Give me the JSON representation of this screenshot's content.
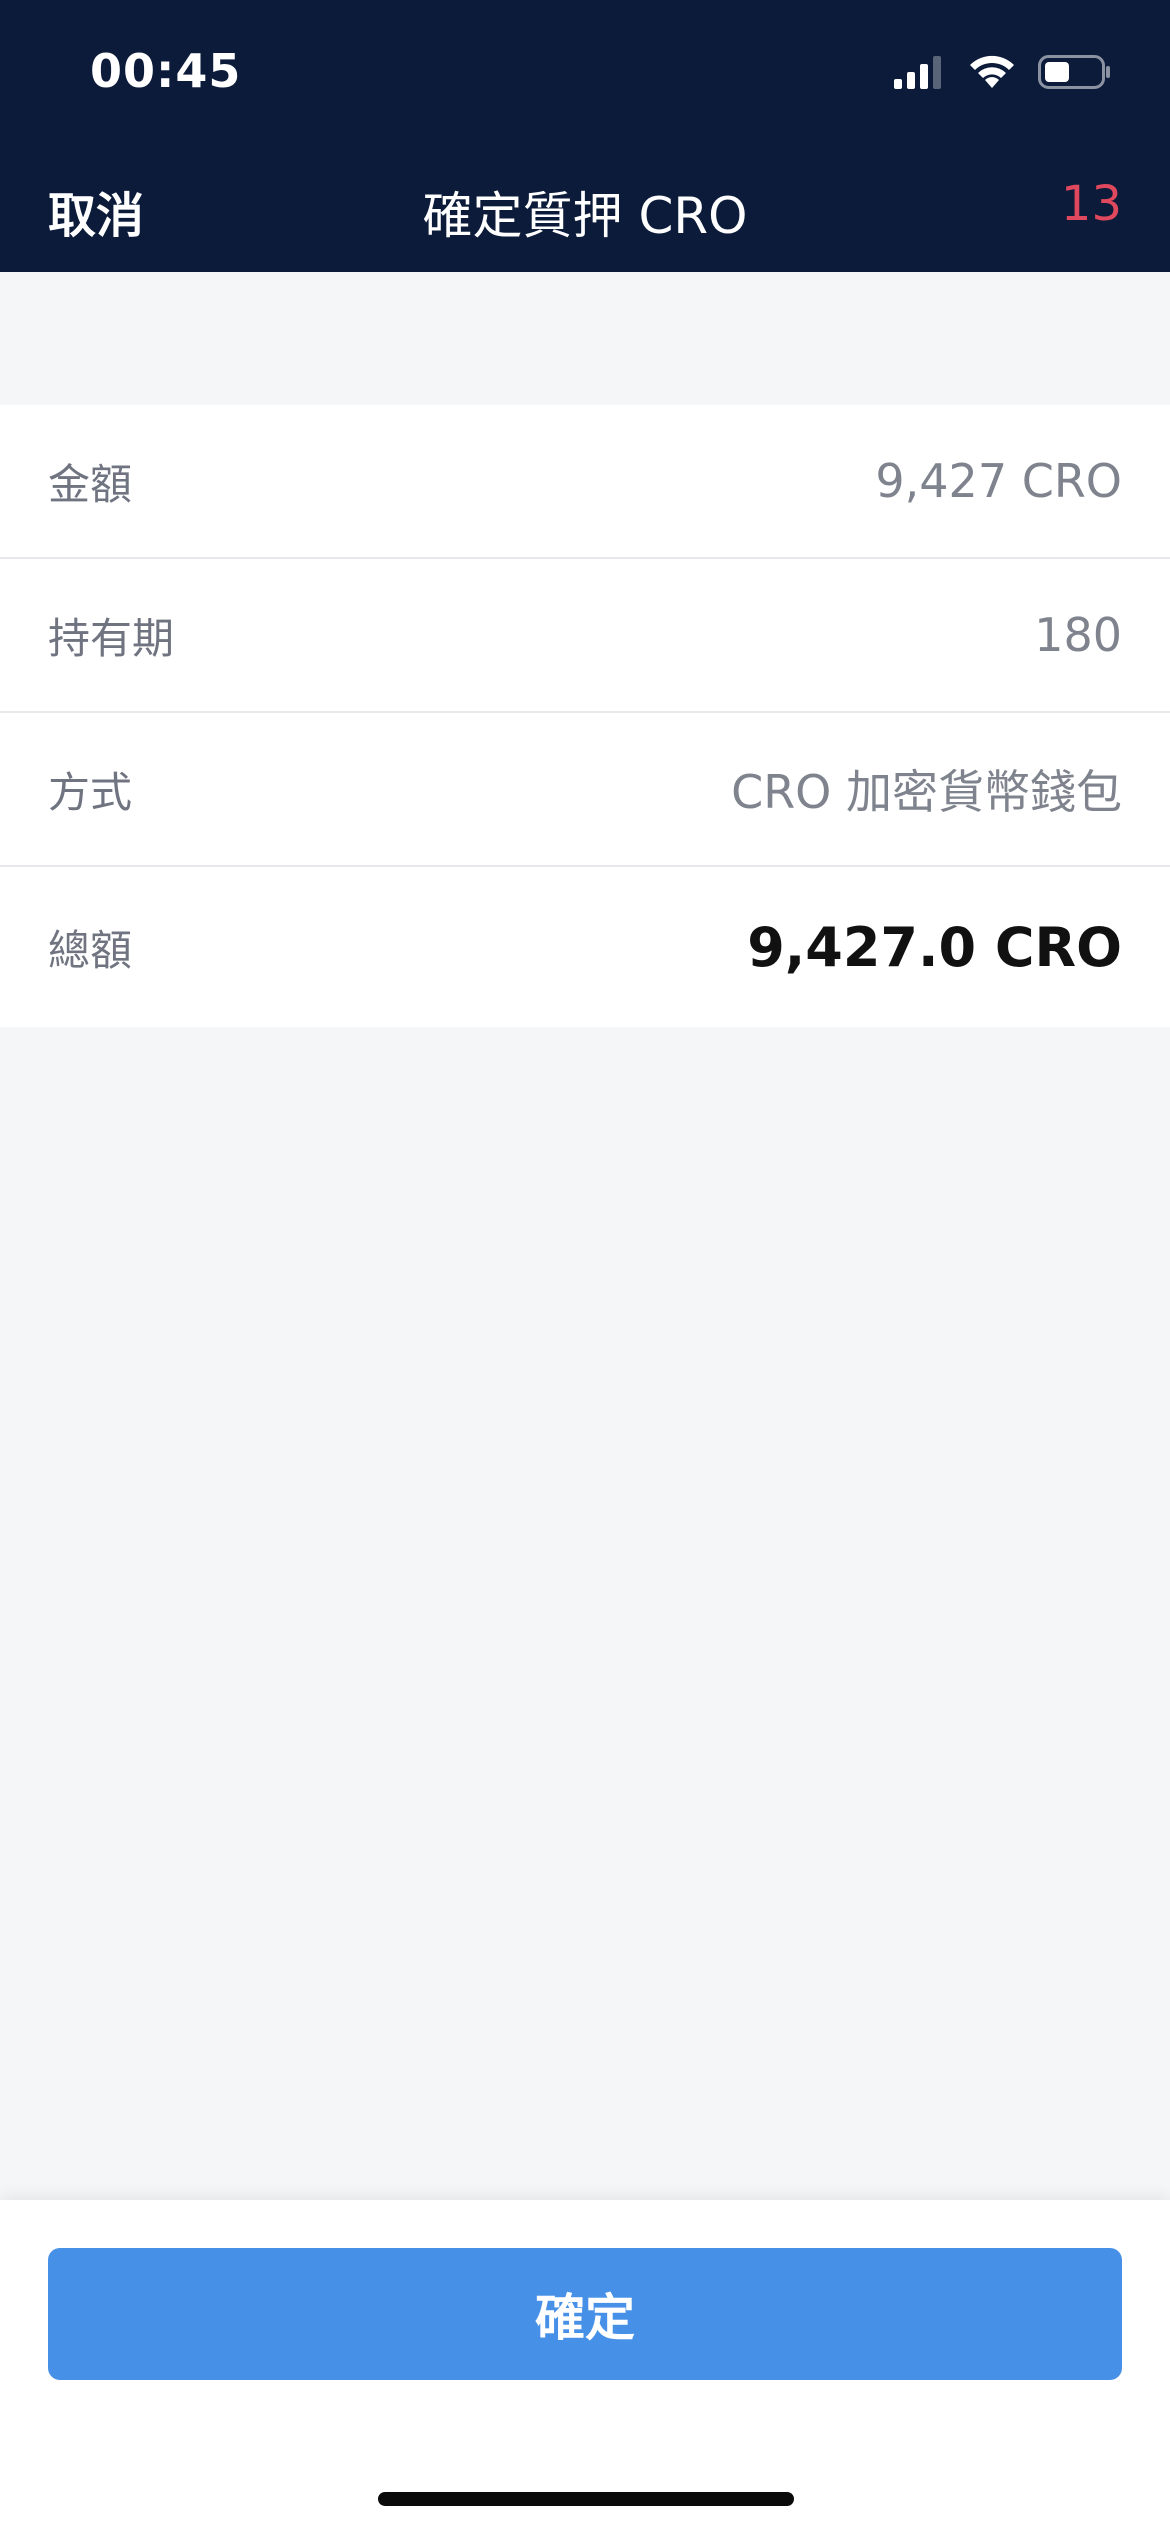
{
  "status_bar": {
    "time": "00:45",
    "icons": [
      "cellular-signal-icon",
      "wifi-icon",
      "battery-icon"
    ]
  },
  "nav": {
    "cancel_label": "取消",
    "title": "確定質押 CRO",
    "countdown": "13"
  },
  "details": {
    "rows": [
      {
        "label": "金額",
        "value": "9,427 CRO"
      },
      {
        "label": "持有期",
        "value": "180"
      },
      {
        "label": "方式",
        "value": "CRO 加密貨幣錢包"
      },
      {
        "label": "總額",
        "value": "9,427.0 CRO"
      }
    ]
  },
  "footer": {
    "confirm_label": "確定"
  },
  "colors": {
    "header_bg": "#0b1b39",
    "accent_button": "#4790e8",
    "countdown": "#e0485d",
    "page_bg": "#f5f6f8"
  }
}
